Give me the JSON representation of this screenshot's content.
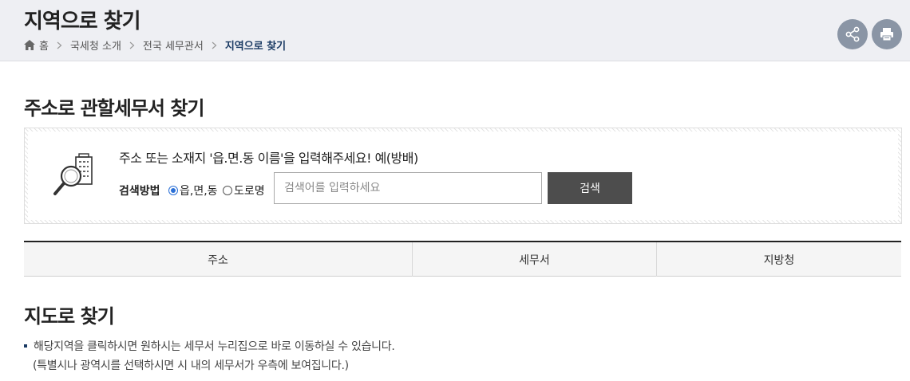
{
  "header": {
    "title": "지역으로 찾기",
    "breadcrumb": [
      "홈",
      "국세청 소개",
      "전국 세무관서",
      "지역으로 찾기"
    ]
  },
  "actions": {
    "share_icon": "share-icon",
    "print_icon": "print-icon"
  },
  "address_search": {
    "title": "주소로 관할세무서 찾기",
    "description": "주소 또는 소재지 '읍.면.동 이름'을 입력해주세요! 예(방배)",
    "method_label": "검색방법",
    "options": [
      "읍,면,동",
      "도로명"
    ],
    "selected_option": "읍,면,동",
    "input_placeholder": "검색어를 입력하세요",
    "input_value": "",
    "button_label": "검색"
  },
  "results_table": {
    "columns": [
      "주소",
      "세무서",
      "지방청"
    ]
  },
  "map_search": {
    "title": "지도로 찾기",
    "info_line1": "해당지역을 클릭하시면 원하시는 세무서 누리집으로 바로 이동하실 수 있습니다.",
    "info_line2": "(특별시나 광역시를 선택하시면 시 내의 세무서가 우측에 보여집니다.)"
  },
  "colors": {
    "header_bg": "#eeeff3",
    "button_dark": "#4d4d4d",
    "circle_button": "#8a95a5",
    "breadcrumb_current": "#1a3a63"
  }
}
